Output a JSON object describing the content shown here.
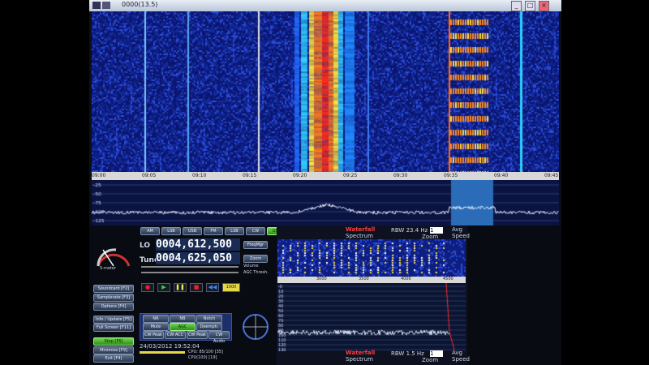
{
  "window": {
    "title": "0000(13.5)",
    "colors": {
      "waterfall_bg": "#0a1a7a",
      "spectrum_bg": "#0b1440",
      "accent": "#3aa0ff"
    }
  },
  "waterfall": {
    "axis_ticks": [
      "09:00",
      "09:05",
      "09:10",
      "09:15",
      "09:20",
      "09:25",
      "09:30",
      "09:35",
      "09:40",
      "09:45"
    ]
  },
  "spectrum": {
    "db_ticks": [
      "-25",
      "-50",
      "-75",
      "-100",
      "-125"
    ]
  },
  "left_panel": {
    "s_meter_label": "S-meter",
    "buttons": [
      "Soundcard [F2]",
      "Samplerate [F3]",
      "Options [F4]"
    ],
    "info_buttons": [
      "Info / Update [F5]",
      "Full Screen [F11]"
    ],
    "stop_button": "Stop [F6]",
    "minimize": "Minimize [F9]",
    "exit": "Exit [F4]"
  },
  "modes": [
    "AM",
    "LSB",
    "USB",
    "FM",
    "LSB",
    "CW",
    "USB",
    "DSB"
  ],
  "freq": {
    "lo_label": "LO",
    "lo_value": "0004,612,500",
    "tune_label": "Tune",
    "tune_value": "0004,625,050",
    "freq_btn": "FreqMgr",
    "auto_btn": "Zoom",
    "volume_label": "Volume",
    "agc_label": "AGC Thresh."
  },
  "transport": {
    "counter": "1000"
  },
  "dsp": {
    "row1": [
      "NR",
      "NB",
      "Notch"
    ],
    "row2": [
      "Mute",
      "AGC",
      "Deemph."
    ],
    "row3": [
      "CW Peak",
      "CW ACC",
      "CW Peak",
      "CW Audio"
    ]
  },
  "status": {
    "datetime": "24/03/2012 19:52:04",
    "cpu": "CPU: 85/100 [35]",
    "cpu2": "CPU(100) [19]"
  },
  "waterfall_panel": {
    "tab1": "Waterfall",
    "tab2": "Spectrum",
    "rbw": "RBW 23.4 Hz",
    "zoom_val": "1",
    "zoom_label": "Zoom",
    "avg_label": "Avg",
    "speed_label": "Speed",
    "x_ticks": [
      "3000",
      "3500",
      "4000",
      "4500"
    ]
  },
  "audio_spectrum": {
    "tab1": "Waterfall",
    "tab2": "Spectrum",
    "rbw": "RBW 1.5 Hz",
    "zoom_val": "1",
    "zoom_label": "Zoom",
    "avg_label": "Avg",
    "speed_label": "Speed",
    "db_ticks": [
      "-0",
      "10",
      "20",
      "30",
      "40",
      "50",
      "60",
      "70",
      "80",
      "90",
      "100",
      "110",
      "120",
      "130"
    ]
  }
}
